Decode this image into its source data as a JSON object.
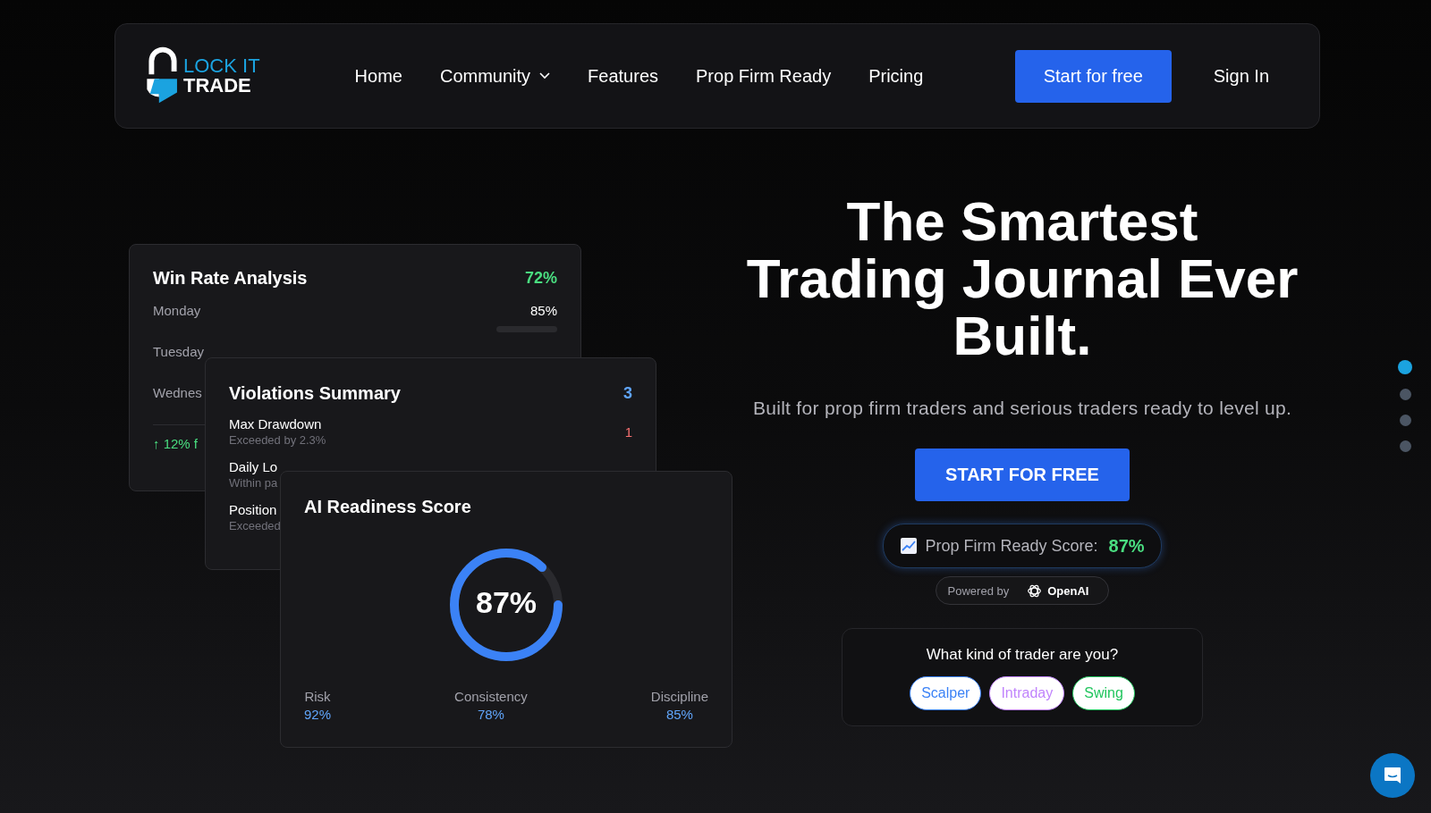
{
  "nav": {
    "logo": {
      "line1": "LOCK IT",
      "line2": "TRADE"
    },
    "links": [
      {
        "label": "Home",
        "dropdown": false
      },
      {
        "label": "Community",
        "dropdown": true
      },
      {
        "label": "Features",
        "dropdown": false
      },
      {
        "label": "Prop Firm Ready",
        "dropdown": false
      },
      {
        "label": "Pricing",
        "dropdown": false
      }
    ],
    "cta": "Start for free",
    "sign_in": "Sign In"
  },
  "win_rate": {
    "title": "Win Rate Analysis",
    "value": "72%",
    "rows": [
      {
        "day": "Monday",
        "value": "85%"
      },
      {
        "day": "Tuesday"
      },
      {
        "day": "Wednes"
      }
    ],
    "footer": "↑ 12% f"
  },
  "violations": {
    "title": "Violations Summary",
    "count": "3",
    "rows": [
      {
        "name": "Max Drawdown",
        "detail": "Exceeded by 2.3%",
        "count": "1"
      },
      {
        "name": "Daily Lo",
        "detail": "Within pa"
      },
      {
        "name": "Position",
        "detail": "Exceeded"
      }
    ]
  },
  "readiness": {
    "title": "AI Readiness Score",
    "score": "87%",
    "level": 0.87,
    "metrics": [
      {
        "label": "Risk",
        "value": "92%"
      },
      {
        "label": "Consistency",
        "value": "78%"
      },
      {
        "label": "Discipline",
        "value": "85%"
      }
    ]
  },
  "hero": {
    "title_lines": [
      "The Smartest",
      "Trading Journal Ever",
      "Built."
    ],
    "subtitle": "Built for prop firm traders and serious traders ready to level up.",
    "button": "START FOR FREE",
    "score_label": "Prop Firm Ready Score:",
    "score_value": "87%",
    "powered_by": "Powered by",
    "powered_brand": "OpenAI",
    "question": "What kind of trader are you?",
    "trader_types": [
      {
        "label": "Scalper",
        "color": "#3b82f6"
      },
      {
        "label": "Intraday",
        "color": "#c084fc"
      },
      {
        "label": "Swing",
        "color": "#22c55e"
      }
    ]
  },
  "pager": [
    {
      "selected": true
    },
    {
      "selected": false
    },
    {
      "selected": false
    },
    {
      "selected": false
    }
  ]
}
